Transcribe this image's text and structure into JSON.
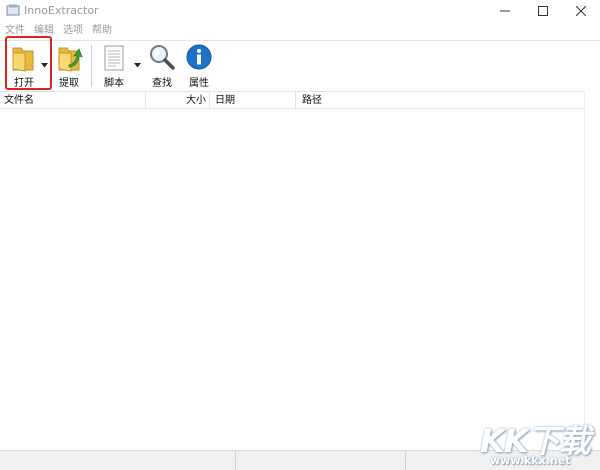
{
  "window": {
    "title": "InnoExtractor"
  },
  "menu": {
    "items": [
      "文件",
      "编辑",
      "选项",
      "帮助"
    ]
  },
  "toolbar": {
    "open_label": "打开",
    "extract_label": "提取",
    "script_label": "脚本",
    "find_label": "查找",
    "properties_label": "属性"
  },
  "list": {
    "columns": [
      "文件名",
      "大小",
      "日期",
      "路径"
    ]
  },
  "watermark": {
    "logo": "KK下载",
    "url": "www.kkx.net"
  },
  "colors": {
    "highlight": "#d9271f",
    "folder": "#f2c94c",
    "info_blue": "#1e73c8",
    "extract_green": "#3aa635"
  }
}
